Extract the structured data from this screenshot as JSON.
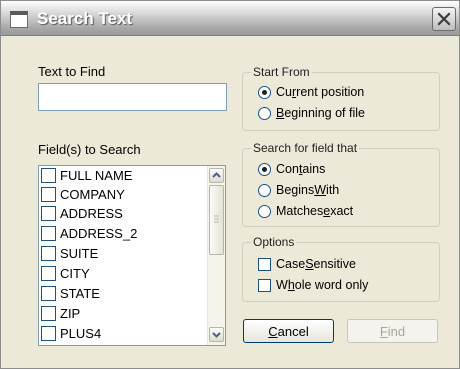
{
  "window": {
    "title": "Search Text"
  },
  "text_to_find": {
    "label": "Text to Find",
    "value": ""
  },
  "fields": {
    "label": "Field(s) to Search",
    "items": [
      "FULL NAME",
      "COMPANY",
      "ADDRESS",
      "ADDRESS_2",
      "SUITE",
      "CITY",
      "STATE",
      "ZIP",
      "PLUS4"
    ]
  },
  "start_from": {
    "legend": "Start From",
    "options": [
      {
        "pre": "Cu",
        "key": "r",
        "post": "rent position",
        "selected": true
      },
      {
        "pre": "",
        "key": "B",
        "post": "eginning of file",
        "selected": false
      }
    ]
  },
  "search_for": {
    "legend": "Search for field that",
    "options": [
      {
        "pre": "Con",
        "key": "t",
        "post": "ains",
        "selected": true
      },
      {
        "pre": "Begins ",
        "key": "W",
        "post": "ith",
        "selected": false
      },
      {
        "pre": "Matches ",
        "key": "e",
        "post": "xact",
        "selected": false
      }
    ]
  },
  "options": {
    "legend": "Options",
    "case": {
      "pre": "Case ",
      "key": "S",
      "post": "ensitive",
      "checked": false
    },
    "whole": {
      "pre": "W",
      "key": "h",
      "post": "ole word only",
      "checked": false
    }
  },
  "buttons": {
    "cancel": {
      "pre": "",
      "key": "C",
      "post": "ancel"
    },
    "find": {
      "pre": "",
      "key": "F",
      "post": "ind"
    }
  }
}
